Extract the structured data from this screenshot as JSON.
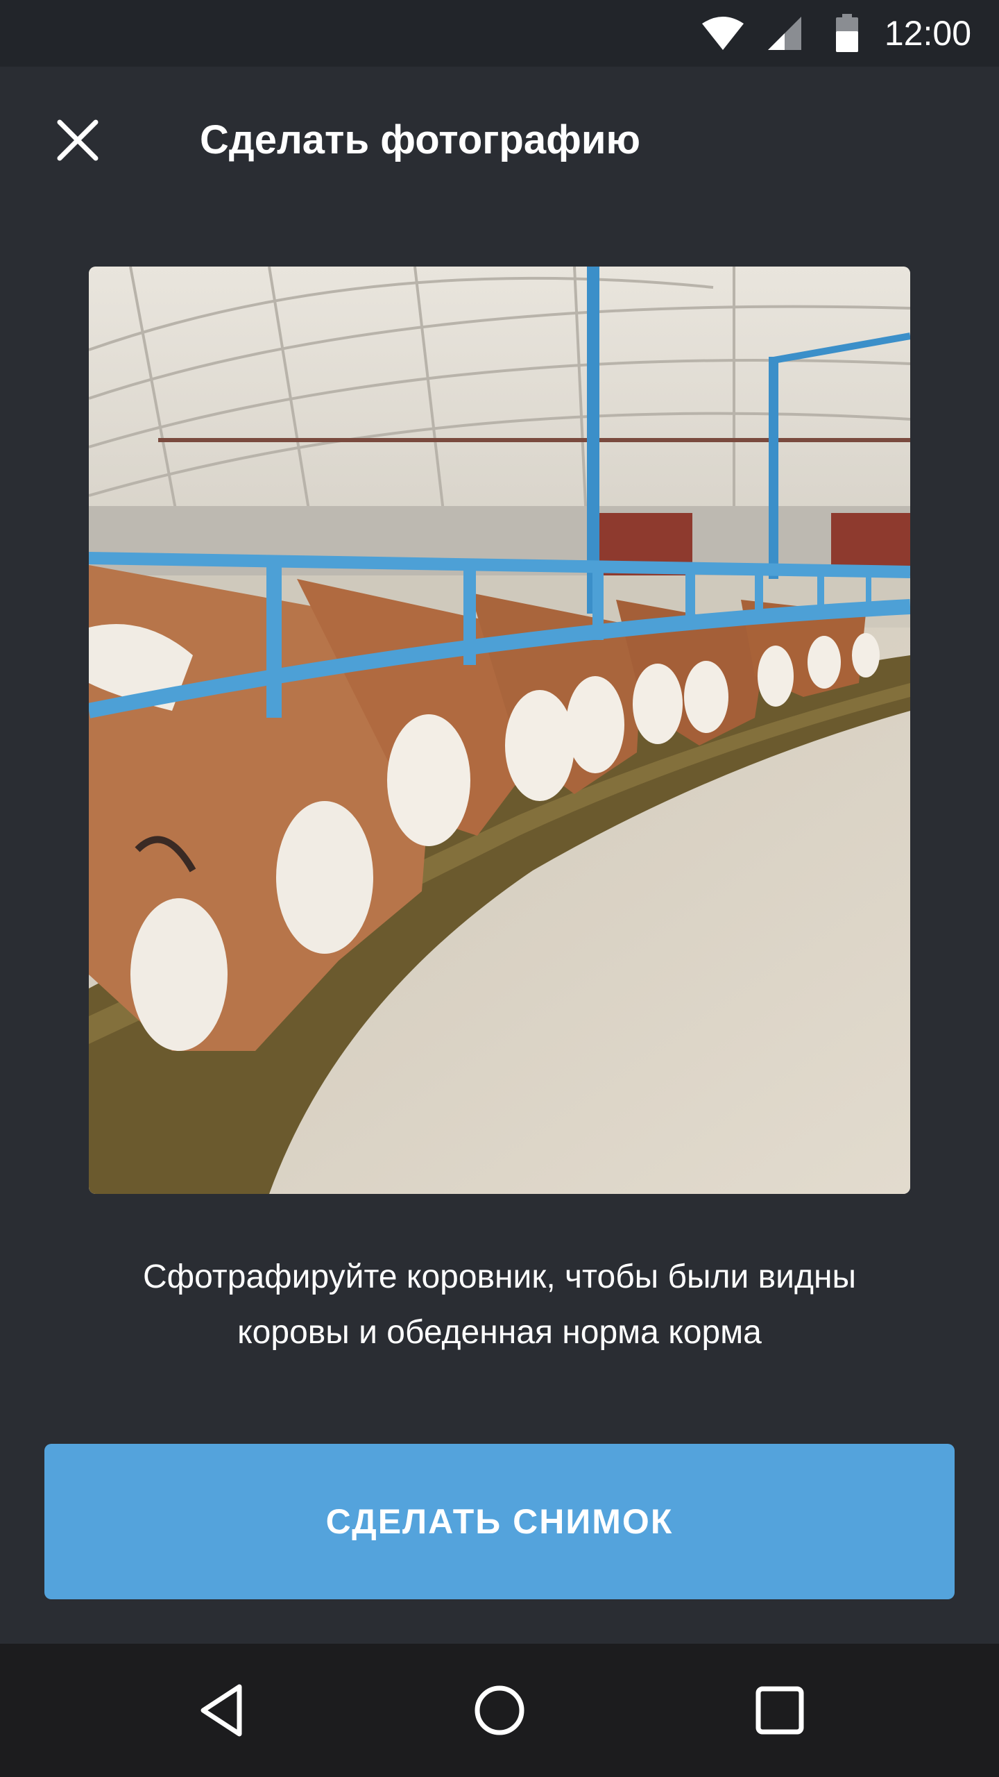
{
  "status_bar": {
    "time": "12:00",
    "icons": [
      "wifi-icon",
      "cell-signal-icon",
      "battery-icon"
    ]
  },
  "toolbar": {
    "close_icon": "close-icon",
    "title": "Сделать фотографию"
  },
  "example_photo": {
    "icon": "cowshed-example-photo"
  },
  "instruction": {
    "line1": "Сфотрафируйте коровник, чтобы были видны",
    "line2": "коровы и обеденная норма корма"
  },
  "primary_button": {
    "label": "СДЕЛАТЬ СНИМОК",
    "color": "#54a3dc"
  },
  "nav_bar": {
    "icons": [
      "back-icon",
      "home-icon",
      "recents-icon"
    ]
  },
  "colors": {
    "background": "#2a2d33",
    "status_bar": "#22252a",
    "nav_bar": "#1c1c1e",
    "accent": "#54a3dc"
  }
}
